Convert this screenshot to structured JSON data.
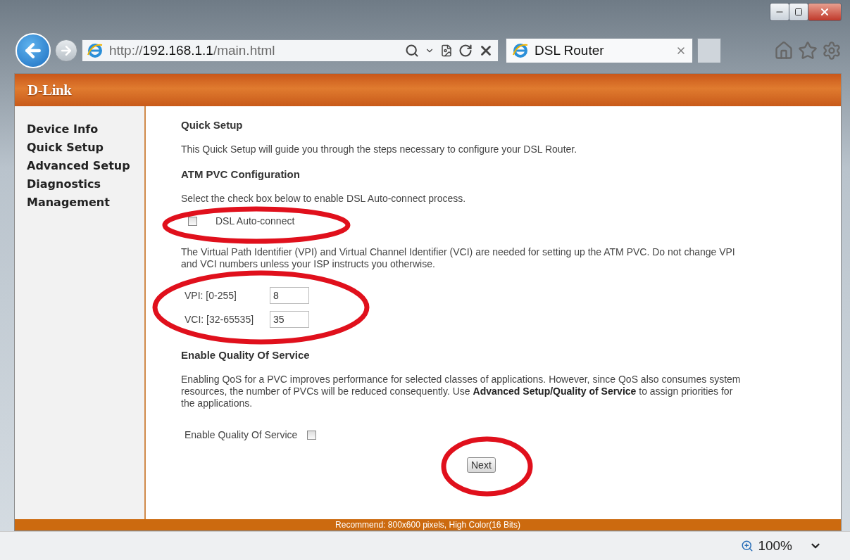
{
  "browser": {
    "address": {
      "scheme": "http://",
      "host": "192.168.1.1",
      "path": "/main.html"
    },
    "tabs": [
      {
        "title": "DSL Router",
        "selected": true
      }
    ],
    "zoom": "100%"
  },
  "header": {
    "logo": "D-Link"
  },
  "sidebar": {
    "items": [
      {
        "label": "Device Info"
      },
      {
        "label": "Quick Setup"
      },
      {
        "label": "Advanced Setup"
      },
      {
        "label": "Diagnostics"
      },
      {
        "label": "Management"
      }
    ]
  },
  "page": {
    "title": "Quick Setup",
    "intro": "This Quick Setup will guide you through the steps necessary to configure your DSL Router.",
    "atm_heading": "ATM PVC Configuration",
    "autoconnect_hint": "Select the check box below to enable DSL Auto-connect process.",
    "autoconnect": {
      "label": "DSL Auto-connect",
      "checked": false
    },
    "vpi_vci_note": "The Virtual Path Identifier (VPI) and Virtual Channel Identifier (VCI) are needed for setting up the ATM PVC. Do not change VPI and VCI numbers unless your ISP instructs you otherwise.",
    "fields": [
      {
        "label": "VPI: [0-255]",
        "value": "8"
      },
      {
        "label": "VCI: [32-65535]",
        "value": "35"
      }
    ],
    "qos_heading": "Enable Quality Of Service",
    "qos_note": "Enabling QoS for a PVC improves performance for selected classes of applications. However, since QoS also consumes system resources, the number of PVCs will be reduced consequently. Use **Advanced Setup/Quality of Service** to assign priorities for the applications.",
    "qos": {
      "label": "Enable Quality Of Service",
      "checked": false
    },
    "next_button": "Next"
  },
  "footer": "Recommend: 800x600 pixels, High Color(16 Bits)"
}
